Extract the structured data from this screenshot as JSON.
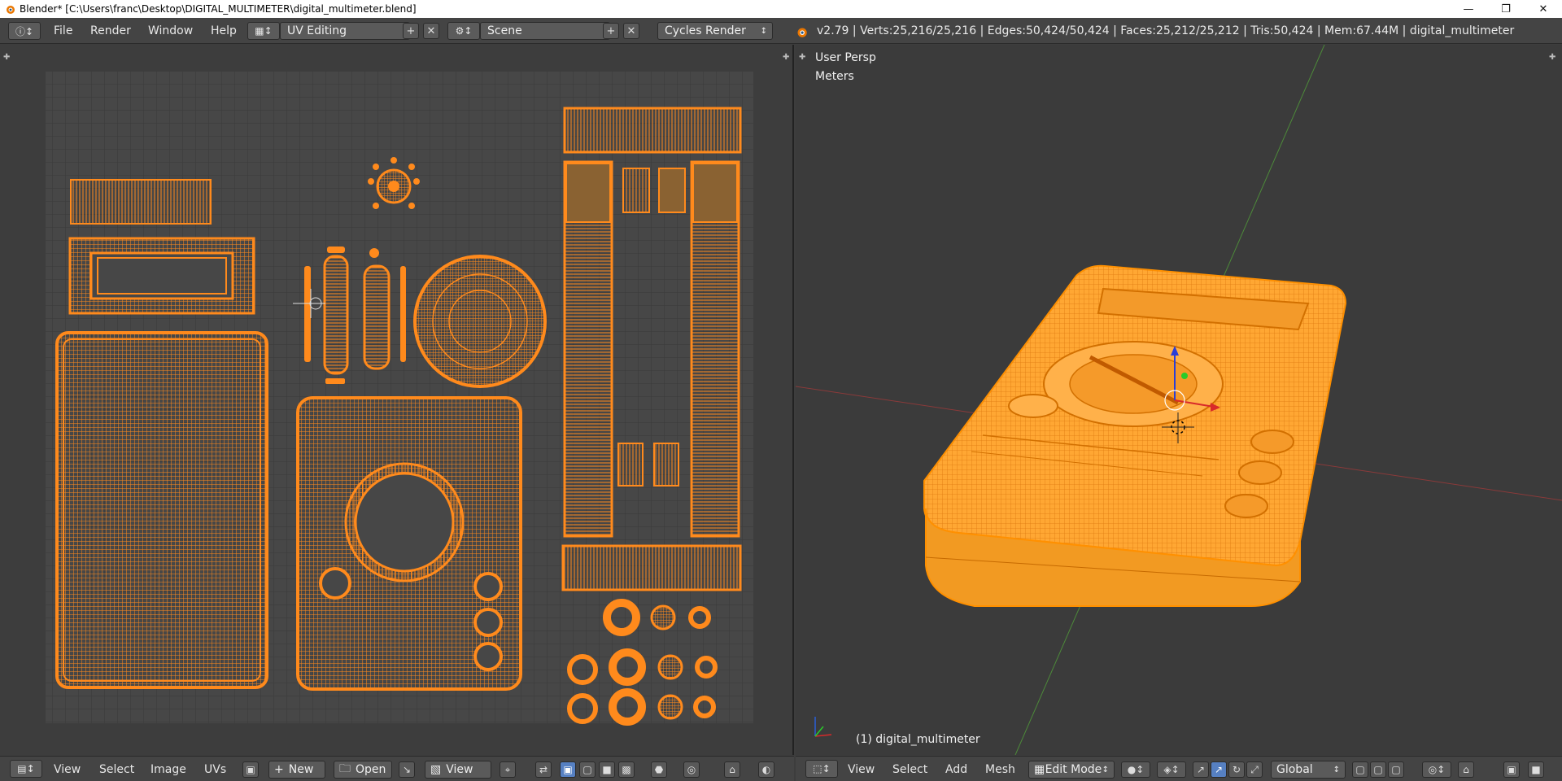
{
  "window": {
    "title": "Blender* [C:\\Users\\franc\\Desktop\\DIGITAL_MULTIMETER\\digital_multimeter.blend]",
    "minimize_icon": "minimize-icon",
    "maximize_icon": "restore-icon",
    "close_icon": "close-icon"
  },
  "infobar": {
    "menus": [
      "File",
      "Render",
      "Window",
      "Help"
    ],
    "screen_layout": "UV Editing",
    "scene": "Scene",
    "render_engine": "Cycles Render",
    "stats": "v2.79 | Verts:25,216/25,216 | Edges:50,424/50,424 | Faces:25,212/25,212 | Tris:50,424 | Mem:67.44M | digital_multimeter"
  },
  "uv_editor": {
    "footer_menus": [
      "View",
      "Select",
      "Image",
      "UVs"
    ],
    "new_label": "New",
    "open_label": "Open",
    "view_label": "View"
  },
  "viewport": {
    "view_name": "User Persp",
    "units": "Meters",
    "object_label": "(1) digital_multimeter",
    "footer_menus": [
      "View",
      "Select",
      "Add",
      "Mesh"
    ],
    "mode": "Edit Mode",
    "orientation": "Global"
  },
  "colors": {
    "uv_orange": "#ff8a1c",
    "mesh_orange": "#ffa733",
    "grid_bg": "#474747",
    "accent_blue": "#5680c2"
  }
}
